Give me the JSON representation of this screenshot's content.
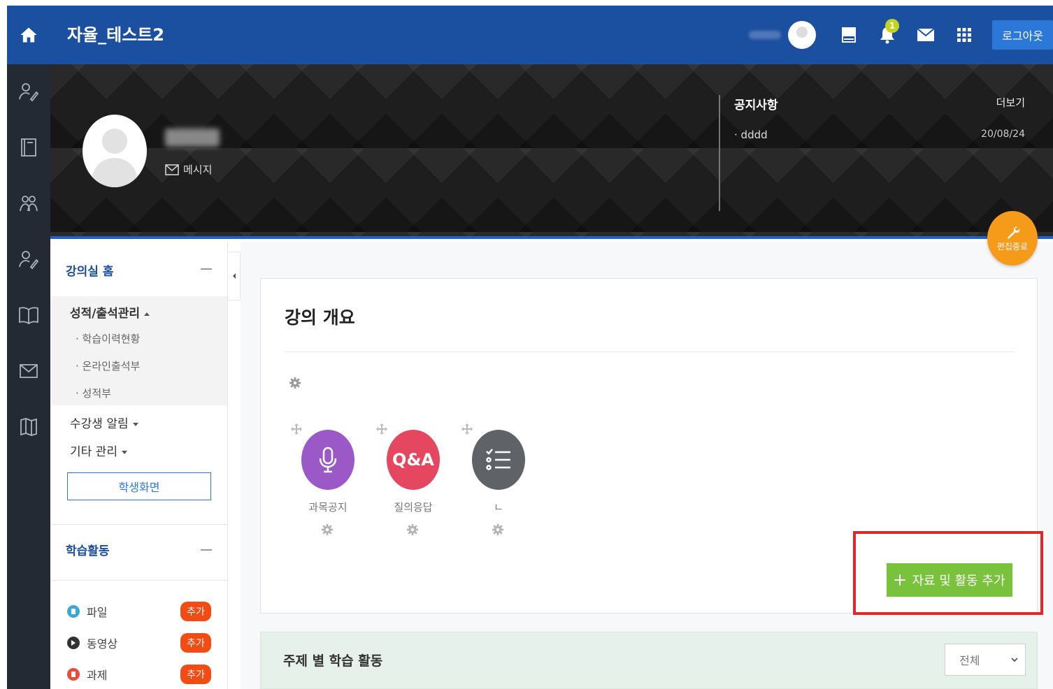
{
  "header": {
    "site_title": "자율_테스트2",
    "bell_count": "1",
    "logout_label": "로그아웃"
  },
  "hero": {
    "message_label": "메시지",
    "notice_title": "공지사항",
    "notice_more": "더보기",
    "notice_items": [
      {
        "title": "dddd",
        "date": "20/08/24"
      }
    ],
    "edit_label": "편집종료"
  },
  "sidebar": {
    "home_label": "강의실 홈",
    "grades_label": "성적/출석관리",
    "grades_sub": [
      "학습이력현황",
      "온라인출석부",
      "성적부"
    ],
    "notify_label": "수강생 알림",
    "other_label": "기타 관리",
    "student_view_label": "학생화면",
    "activities_title": "학습활동",
    "activities": [
      {
        "label": "파일",
        "add": "추가"
      },
      {
        "label": "동영상",
        "add": "추가"
      },
      {
        "label": "과제",
        "add": "추가"
      }
    ]
  },
  "main": {
    "overview_title": "강의 개요",
    "modules": [
      {
        "label": "과목공지",
        "icon": "microphone-icon",
        "text": ""
      },
      {
        "label": "질의응답",
        "icon": "qa-icon",
        "text": "Q&A"
      },
      {
        "label": "ㄴ",
        "icon": "checklist-icon",
        "text": ""
      }
    ],
    "add_button_label": "자료 및 활동 추가",
    "topic_title": "주제 별 학습 활동",
    "topic_select_value": "전체"
  },
  "colors": {
    "header_blue": "#1b4fa0",
    "rail_dark": "#232a33",
    "purple": "#9b59c8",
    "pink": "#e4475f",
    "gray": "#5f6368",
    "green": "#79c23c",
    "orange": "#f59b19",
    "red_highlight": "#e0282b",
    "add_badge": "#f24b14"
  }
}
